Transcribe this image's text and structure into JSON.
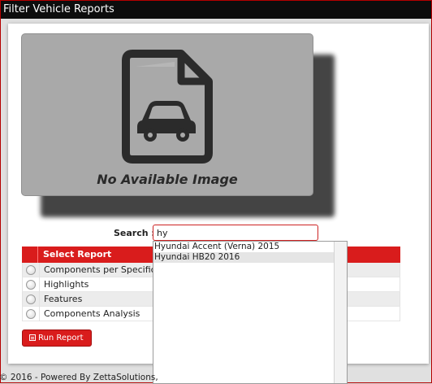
{
  "window": {
    "title": "Filter Vehicle Reports"
  },
  "image_placeholder": {
    "text": "No Available Image",
    "icon": "car-document-icon"
  },
  "search": {
    "label": "Search :",
    "value": "hy"
  },
  "reports": {
    "header": "Select Report",
    "items": [
      {
        "label": "Components per Specificat"
      },
      {
        "label": "Highlights"
      },
      {
        "label": "Features"
      },
      {
        "label": "Components Analysis"
      }
    ]
  },
  "run_button": {
    "label": "Run Report"
  },
  "autocomplete": {
    "items": [
      {
        "label": "Hyundai Accent (Verna) 2015",
        "highlighted": false
      },
      {
        "label": "Hyundai HB20 2016",
        "highlighted": true
      }
    ]
  },
  "footer": {
    "text": "© 2016 - Powered By ZettaSolutions,"
  },
  "colors": {
    "accent": "#d91c1c",
    "titlebar": "#0d0d0d"
  }
}
